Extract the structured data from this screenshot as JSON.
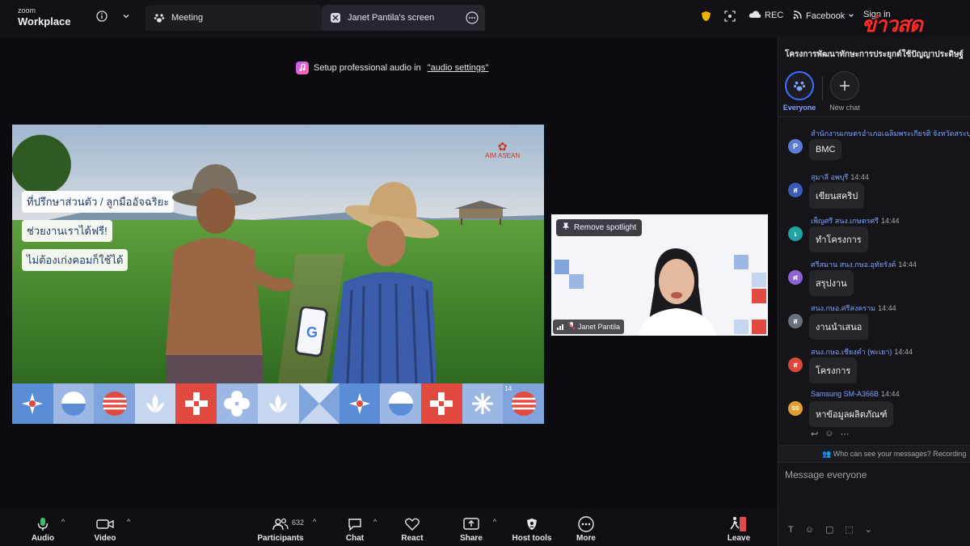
{
  "app": {
    "brand_top": "zoom",
    "brand_name": "Workplace"
  },
  "tabs": [
    {
      "label": "Meeting",
      "icon": "paw-icon"
    },
    {
      "label": "Janet Pantila's screen",
      "icon": "share-screen-icon"
    }
  ],
  "top_right": {
    "rec_label": "REC",
    "facebook_label": "Facebook",
    "sign_in_label": "Sign in",
    "watermark": "ข่าวสด"
  },
  "audio_banner": {
    "text": "Setup professional audio in",
    "link": "\"audio settings\""
  },
  "slide": {
    "bubbles": [
      "ที่ปรึกษาส่วนตัว / ลูกมืออัจฉริยะ",
      "ช่วยงานเราได้ฟรี!",
      "ไม่ต้องเก่งคอมก็ใช้ได้"
    ],
    "logo_text": "AIM ASEAN",
    "pattern_count_label": "14"
  },
  "video": {
    "remove_spotlight_label": "Remove spotlight",
    "participant_name": "Janet Pantila"
  },
  "chat": {
    "title": "โครงการพัฒนาทักษะการประยุกต์ใช้ปัญญาประดิษฐ์",
    "tabs": [
      {
        "label": "Everyone"
      },
      {
        "label": "New chat"
      }
    ],
    "messages": [
      {
        "sender": "สำนักงานเกษตรอำเภอเฉลิมพระเกียรติ จังหวัดสระบุรี",
        "time": "",
        "text": "BMC",
        "initial": "P",
        "color": "#5b7bd5"
      },
      {
        "sender": "สุมาลี อพบุรี",
        "time": "14:44",
        "text": "เขียนสคริป",
        "initial": "ส",
        "color": "#3b5bb8"
      },
      {
        "sender": "เพ็ญศรี สนง.เกษตรศรี",
        "time": "14:44",
        "text": "ทำโครงการ",
        "initial": "เ",
        "color": "#21a3a3"
      },
      {
        "sender": "ศรีสมาน สนง.กษอ.อุทัยรังค์",
        "time": "14:44",
        "text": "สรุปงาน",
        "initial": "ศ",
        "color": "#8d63d6"
      },
      {
        "sender": "สนง.กษอ.ศรีสงคราม",
        "time": "14:44",
        "text": "งานนำเสนอ",
        "initial": "ส",
        "color": "#6a6f7d"
      },
      {
        "sender": "สนง.กษอ.เชียงคำ (พะเยา)",
        "time": "14:44",
        "text": "โครงการ",
        "initial": "ส",
        "color": "#d9483b"
      },
      {
        "sender": "Samsung SM-A366B",
        "time": "14:44",
        "text": "หาข้อมูลผลิตภัณฑ์",
        "initial": "SS",
        "color": "#e0a030"
      }
    ],
    "who_can_see": "Who can see your messages? Recording",
    "compose_placeholder": "Message everyone"
  },
  "toolbar": {
    "audio": "Audio",
    "video": "Video",
    "participants": "Participants",
    "participants_count": "632",
    "chat": "Chat",
    "react": "React",
    "share": "Share",
    "host_tools": "Host tools",
    "more": "More",
    "leave": "Leave"
  },
  "colors": {
    "accent": "#3d6fff",
    "leave": "#e5484d",
    "chat_sender": "#7ea2ff"
  }
}
